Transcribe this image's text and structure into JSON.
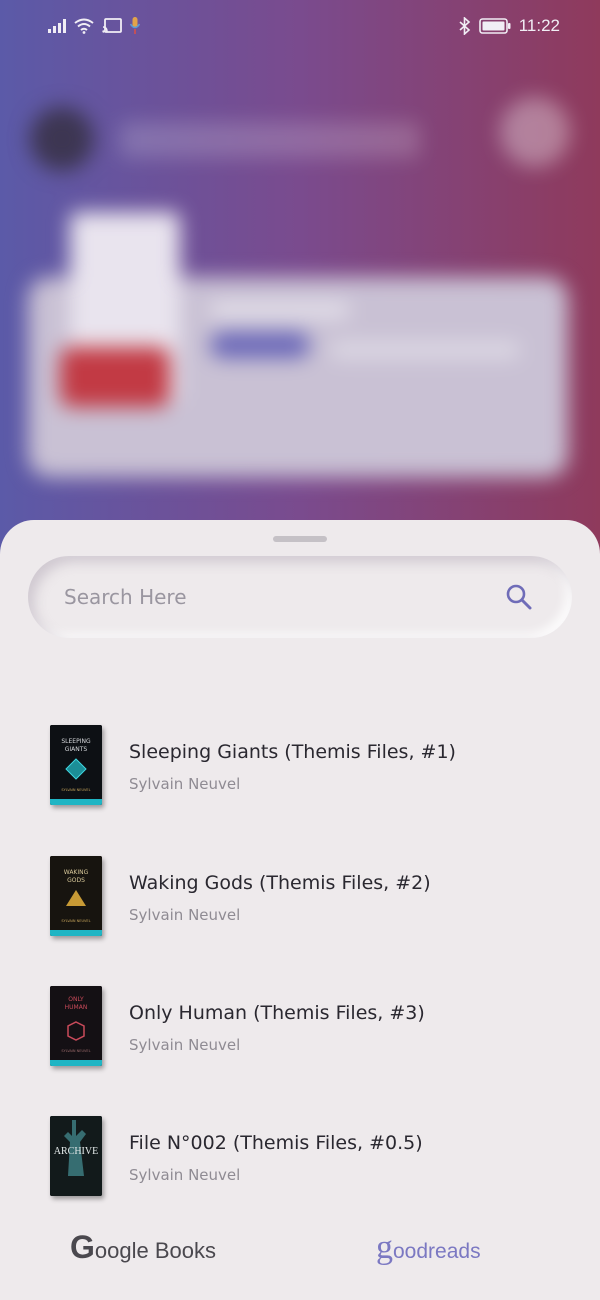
{
  "status_bar": {
    "time": "11:22",
    "icons": [
      "signal-icon",
      "wifi-icon",
      "cast-icon",
      "mic-icon",
      "bluetooth-icon",
      "battery-icon"
    ]
  },
  "search": {
    "placeholder": "Search Here"
  },
  "books": [
    {
      "title": "Sleeping Giants (Themis Files, #1)",
      "author": "Sylvain Neuvel",
      "cover_text": "SLEEPING GIANTS"
    },
    {
      "title": "Waking Gods (Themis Files, #2)",
      "author": "Sylvain Neuvel",
      "cover_text": "WAKING GODS"
    },
    {
      "title": "Only Human (Themis Files, #3)",
      "author": "Sylvain Neuvel",
      "cover_text": "ONLY HUMAN"
    },
    {
      "title": "File N°002 (Themis Files, #0.5)",
      "author": "Sylvain Neuvel",
      "cover_text": "ARCHIVE"
    }
  ],
  "nav": {
    "google_books": {
      "g": "G",
      "text": "oogle Books"
    },
    "goodreads": {
      "g": "g",
      "text": "oodreads"
    }
  },
  "colors": {
    "accent": "#7b78c2",
    "sheet_bg": "#eeeaec",
    "gradient_left": "#5b5aa8",
    "gradient_right": "#8f3a5c"
  }
}
